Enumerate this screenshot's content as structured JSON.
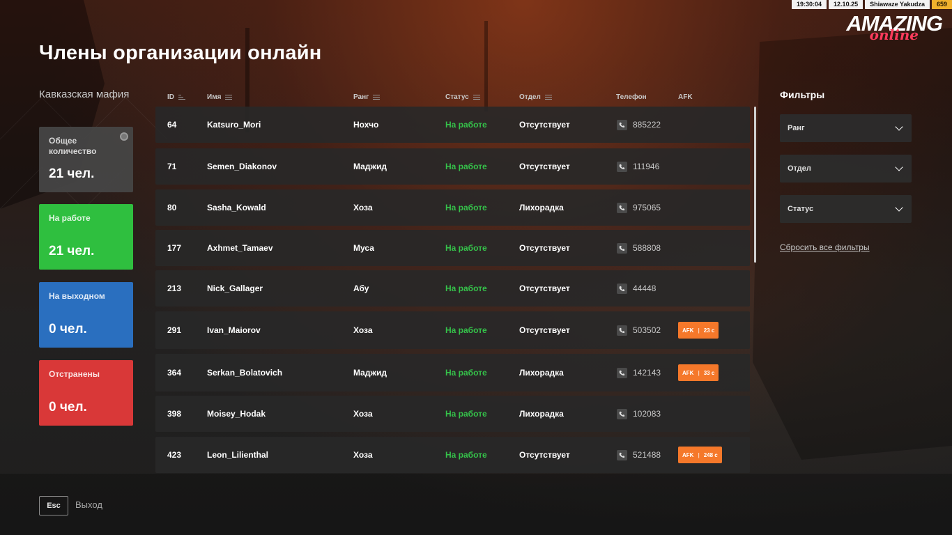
{
  "hud": {
    "time": "19:30:04",
    "date": "12.10.25",
    "player": "Shiawaze Yakudza",
    "money": "659"
  },
  "logo": {
    "main": "AMAZING",
    "sub": "online"
  },
  "page": {
    "title": "Члены организации онлайн",
    "org_name": "Кавказская мафия"
  },
  "stats": {
    "total": {
      "label": "Общее количество",
      "value": "21 чел.",
      "color": "#464646"
    },
    "working": {
      "label": "На работе",
      "value": "21 чел.",
      "color": "#2fbf3f"
    },
    "day_off": {
      "label": "На выходном",
      "value": "0 чел.",
      "color": "#2a6fbf"
    },
    "suspended": {
      "label": "Отстранены",
      "value": "0 чел.",
      "color": "#d93838"
    }
  },
  "table": {
    "columns": {
      "id": "ID",
      "name": "Имя",
      "rank": "Ранг",
      "status": "Статус",
      "dept": "Отдел",
      "phone": "Телефон",
      "afk": "AFK"
    },
    "rows": [
      {
        "id": "64",
        "name": "Katsuro_Mori",
        "rank": "Нохчо",
        "status": "На работе",
        "dept": "Отсутствует",
        "phone": "885222",
        "afk": null
      },
      {
        "id": "71",
        "name": "Semen_Diakonov",
        "rank": "Маджид",
        "status": "На работе",
        "dept": "Отсутствует",
        "phone": "111946",
        "afk": null
      },
      {
        "id": "80",
        "name": "Sasha_Kowald",
        "rank": "Хоза",
        "status": "На работе",
        "dept": "Лихорадка",
        "phone": "975065",
        "afk": null
      },
      {
        "id": "177",
        "name": "Axhmet_Tamaev",
        "rank": "Муса",
        "status": "На работе",
        "dept": "Отсутствует",
        "phone": "588808",
        "afk": null
      },
      {
        "id": "213",
        "name": "Nick_Gallager",
        "rank": "Абу",
        "status": "На работе",
        "dept": "Отсутствует",
        "phone": "44448",
        "afk": null
      },
      {
        "id": "291",
        "name": "Ivan_Maiorov",
        "rank": "Хоза",
        "status": "На работе",
        "dept": "Отсутствует",
        "phone": "503502",
        "afk": {
          "label": "AFK",
          "time": "23 с"
        }
      },
      {
        "id": "364",
        "name": "Serkan_Bolatovich",
        "rank": "Маджид",
        "status": "На работе",
        "dept": "Лихорадка",
        "phone": "142143",
        "afk": {
          "label": "AFK",
          "time": "33 с"
        }
      },
      {
        "id": "398",
        "name": "Moisey_Hodak",
        "rank": "Хоза",
        "status": "На работе",
        "dept": "Лихорадка",
        "phone": "102083",
        "afk": null
      },
      {
        "id": "423",
        "name": "Leon_Lilienthal",
        "rank": "Хоза",
        "status": "На работе",
        "dept": "Отсутствует",
        "phone": "521488",
        "afk": {
          "label": "AFK",
          "time": "248 с"
        }
      }
    ]
  },
  "filters": {
    "title": "Фильтры",
    "rank": "Ранг",
    "dept": "Отдел",
    "status": "Статус",
    "reset": "Сбросить все фильтры"
  },
  "footer": {
    "esc_key": "Esc",
    "exit_label": "Выход"
  }
}
